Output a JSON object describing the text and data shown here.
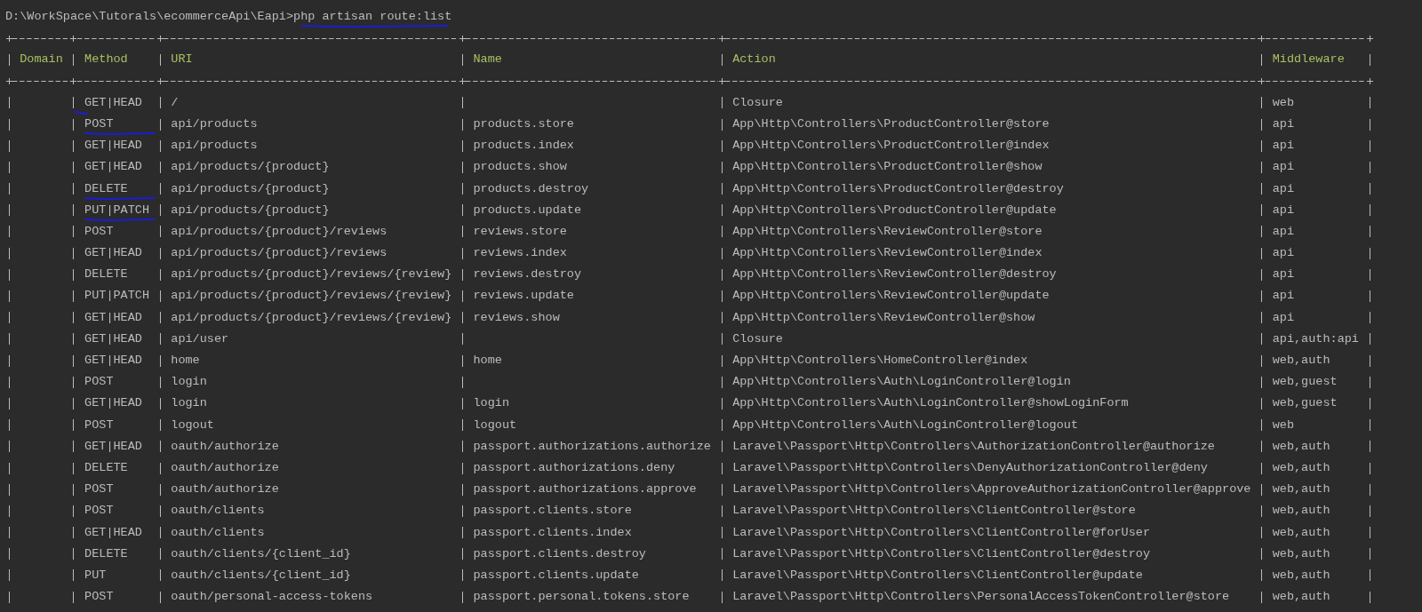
{
  "terminal": {
    "prompt": "D:\\WorkSpace\\Tutorals\\ecommerceApi\\Eapi>",
    "command": "php artisan route:list",
    "command_underlined": true,
    "columns": [
      "Domain",
      "Method",
      "URI",
      "Name",
      "Action",
      "Middleware"
    ],
    "rows": [
      {
        "method": "GET|HEAD",
        "uri": "/",
        "action": "Closure",
        "middleware": "web",
        "method_underlined": false,
        "method_ticked": true
      },
      {
        "method": "POST",
        "uri": "api/products",
        "name": "products.store",
        "action": "App\\Http\\Controllers\\ProductController@store",
        "middleware": "api",
        "method_underlined": true,
        "method_ticked": false
      },
      {
        "method": "GET|HEAD",
        "uri": "api/products",
        "name": "products.index",
        "action": "App\\Http\\Controllers\\ProductController@index",
        "middleware": "api",
        "method_underlined": false,
        "method_ticked": false
      },
      {
        "method": "GET|HEAD",
        "uri": "api/products/{product}",
        "name": "products.show",
        "action": "App\\Http\\Controllers\\ProductController@show",
        "middleware": "api",
        "method_underlined": false,
        "method_ticked": false
      },
      {
        "method": "DELETE",
        "uri": "api/products/{product}",
        "name": "products.destroy",
        "action": "App\\Http\\Controllers\\ProductController@destroy",
        "middleware": "api",
        "method_underlined": true,
        "method_ticked": false
      },
      {
        "method": "PUT|PATCH",
        "uri": "api/products/{product}",
        "name": "products.update",
        "action": "App\\Http\\Controllers\\ProductController@update",
        "middleware": "api",
        "method_underlined": true,
        "method_ticked": false
      },
      {
        "method": "POST",
        "uri": "api/products/{product}/reviews",
        "name": "reviews.store",
        "action": "App\\Http\\Controllers\\ReviewController@store",
        "middleware": "api",
        "method_underlined": false,
        "method_ticked": false
      },
      {
        "method": "GET|HEAD",
        "uri": "api/products/{product}/reviews",
        "name": "reviews.index",
        "action": "App\\Http\\Controllers\\ReviewController@index",
        "middleware": "api",
        "method_underlined": false,
        "method_ticked": false
      },
      {
        "method": "DELETE",
        "uri": "api/products/{product}/reviews/{review}",
        "name": "reviews.destroy",
        "action": "App\\Http\\Controllers\\ReviewController@destroy",
        "middleware": "api",
        "method_underlined": false,
        "method_ticked": false
      },
      {
        "method": "PUT|PATCH",
        "uri": "api/products/{product}/reviews/{review}",
        "name": "reviews.update",
        "action": "App\\Http\\Controllers\\ReviewController@update",
        "middleware": "api",
        "method_underlined": false,
        "method_ticked": false
      },
      {
        "method": "GET|HEAD",
        "uri": "api/products/{product}/reviews/{review}",
        "name": "reviews.show",
        "action": "App\\Http\\Controllers\\ReviewController@show",
        "middleware": "api",
        "method_underlined": false,
        "method_ticked": false
      },
      {
        "method": "GET|HEAD",
        "uri": "api/user",
        "action": "Closure",
        "middleware": "api,auth:api",
        "method_underlined": false,
        "method_ticked": false
      },
      {
        "method": "GET|HEAD",
        "uri": "home",
        "name": "home",
        "action": "App\\Http\\Controllers\\HomeController@index",
        "middleware": "web,auth",
        "method_underlined": false,
        "method_ticked": false
      },
      {
        "method": "POST",
        "uri": "login",
        "action": "App\\Http\\Controllers\\Auth\\LoginController@login",
        "middleware": "web,guest",
        "method_underlined": false,
        "method_ticked": false
      },
      {
        "method": "GET|HEAD",
        "uri": "login",
        "name": "login",
        "action": "App\\Http\\Controllers\\Auth\\LoginController@showLoginForm",
        "middleware": "web,guest",
        "method_underlined": false,
        "method_ticked": false
      },
      {
        "method": "POST",
        "uri": "logout",
        "name": "logout",
        "action": "App\\Http\\Controllers\\Auth\\LoginController@logout",
        "middleware": "web",
        "method_underlined": false,
        "method_ticked": false
      },
      {
        "method": "GET|HEAD",
        "uri": "oauth/authorize",
        "name": "passport.authorizations.authorize",
        "action": "Laravel\\Passport\\Http\\Controllers\\AuthorizationController@authorize",
        "middleware": "web,auth",
        "method_underlined": false,
        "method_ticked": false
      },
      {
        "method": "DELETE",
        "uri": "oauth/authorize",
        "name": "passport.authorizations.deny",
        "action": "Laravel\\Passport\\Http\\Controllers\\DenyAuthorizationController@deny",
        "middleware": "web,auth",
        "method_underlined": false,
        "method_ticked": false
      },
      {
        "method": "POST",
        "uri": "oauth/authorize",
        "name": "passport.authorizations.approve",
        "action": "Laravel\\Passport\\Http\\Controllers\\ApproveAuthorizationController@approve",
        "middleware": "web,auth",
        "method_underlined": false,
        "method_ticked": false
      },
      {
        "method": "POST",
        "uri": "oauth/clients",
        "name": "passport.clients.store",
        "action": "Laravel\\Passport\\Http\\Controllers\\ClientController@store",
        "middleware": "web,auth",
        "method_underlined": false,
        "method_ticked": false
      },
      {
        "method": "GET|HEAD",
        "uri": "oauth/clients",
        "name": "passport.clients.index",
        "action": "Laravel\\Passport\\Http\\Controllers\\ClientController@forUser",
        "middleware": "web,auth",
        "method_underlined": false,
        "method_ticked": false
      },
      {
        "method": "DELETE",
        "uri": "oauth/clients/{client_id}",
        "name": "passport.clients.destroy",
        "action": "Laravel\\Passport\\Http\\Controllers\\ClientController@destroy",
        "middleware": "web,auth",
        "method_underlined": false,
        "method_ticked": false
      },
      {
        "method": "PUT",
        "uri": "oauth/clients/{client_id}",
        "name": "passport.clients.update",
        "action": "Laravel\\Passport\\Http\\Controllers\\ClientController@update",
        "middleware": "web,auth",
        "method_underlined": false,
        "method_ticked": false
      },
      {
        "method": "POST",
        "uri": "oauth/personal-access-tokens",
        "name": "passport.personal.tokens.store",
        "action": "Laravel\\Passport\\Http\\Controllers\\PersonalAccessTokenController@store",
        "middleware": "web,auth",
        "method_underlined": false,
        "method_ticked": false
      }
    ]
  }
}
